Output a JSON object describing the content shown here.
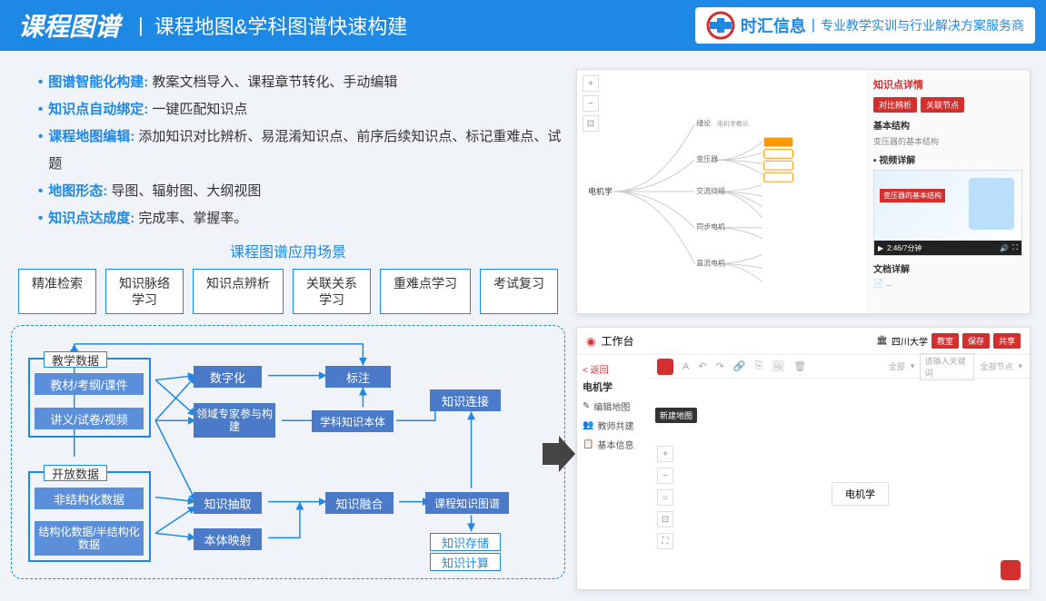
{
  "header": {
    "title": "课程图谱",
    "subtitle": "课程地图&学科图谱快速构建",
    "brand": "时汇信息",
    "tagline": "专业教学实训与行业解决方案服务商"
  },
  "bullets": [
    {
      "label": "图谱智能化构建:",
      "text": " 教案文档导入、课程章节转化、手动编辑"
    },
    {
      "label": "知识点自动绑定:",
      "text": "  一键匹配知识点"
    },
    {
      "label": "课程地图编辑:",
      "text": " 添加知识对比辨析、易混淆知识点、前序后续知识点、标记重难点、试题"
    },
    {
      "label": "地图形态:",
      "text": " 导图、辐射图、大纲视图"
    },
    {
      "label": "知识点达成度:",
      "text": " 完成率、掌握率。"
    }
  ],
  "scene": {
    "title": "课程图谱应用场景",
    "items": [
      "精准检索",
      "知识脉络\n学习",
      "知识点辨析",
      "关联关系\n学习",
      "重难点学习",
      "考试复习"
    ]
  },
  "flow": {
    "group1_label": "教学数据",
    "group1_items": [
      "教材/考纲/课件",
      "讲义/试卷/视频"
    ],
    "group2_label": "开放数据",
    "group2_items": [
      "非结构化数据",
      "结构化数据/半结构化数据"
    ],
    "nodes": {
      "digitize": "数字化",
      "annotate": "标注",
      "expert": "领域专家参与构建",
      "ontology": "学科知识本体",
      "extract": "知识抽取",
      "mapping": "本体映射",
      "fusion": "知识融合",
      "connect": "知识连接",
      "graph": "课程知识图谱",
      "store": "知识存储",
      "compute": "知识计算"
    }
  },
  "shot1": {
    "root": "电机学",
    "level2": [
      "绪论",
      "变压器",
      "交流绕组",
      "同步电机",
      "直流电机"
    ],
    "right_panel": {
      "title": "知识点详情",
      "tab1": "对比辨析",
      "tab2": "关联节点",
      "section1": "基本结构",
      "sub1": "变压器的基本结构",
      "section2": "• 视频详解",
      "video_caption": "变压器的基本结构",
      "video_time": "2:46/7分钟",
      "section3": "文档详解"
    }
  },
  "shot2": {
    "workspace": "工作台",
    "crumb_back": "< 返回",
    "crumb_title": "电机学",
    "sidebar": [
      "编辑地图",
      "教师共建",
      "基本信息"
    ],
    "univ": "四川大学",
    "btns": [
      "教室",
      "保存",
      "共享"
    ],
    "filter1": "全部",
    "search_ph": "请输入关键词",
    "filter2": "全部节点",
    "tooltip": "新建地图",
    "center": "电机学"
  }
}
